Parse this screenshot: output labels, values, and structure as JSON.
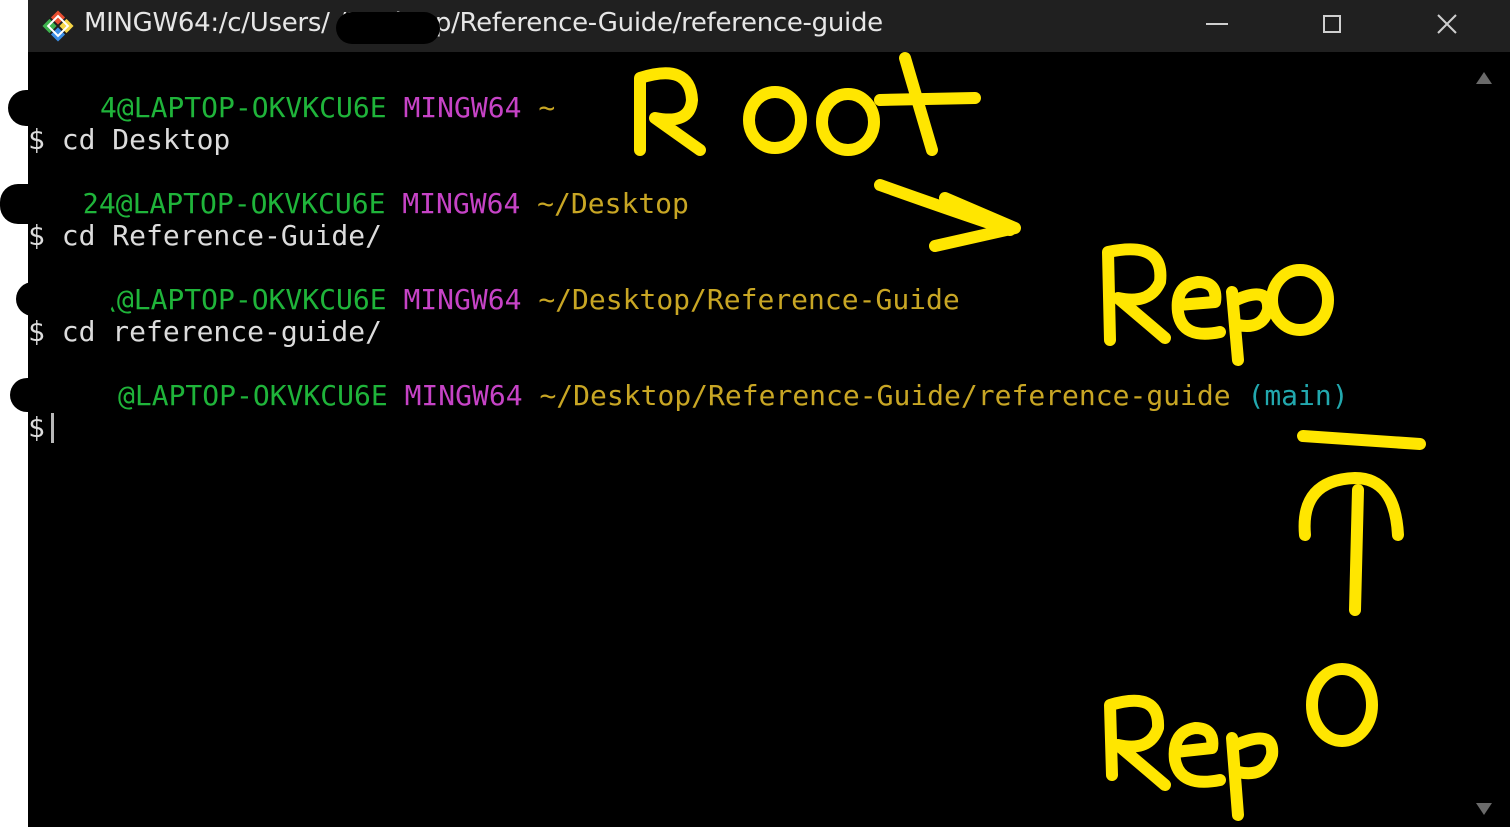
{
  "window": {
    "title": "MINGW64:/c/Users/      /Desktop/Reference-Guide/reference-guide",
    "buttons": {
      "minimize": "minimize-icon",
      "maximize": "maximize-icon",
      "close": "close-icon"
    }
  },
  "terminal": {
    "blocks": [
      {
        "user_host": "4@LAPTOP-OKVKCU6E",
        "shell": "MINGW64",
        "path": "~",
        "branch": "",
        "command": "$ cd Desktop"
      },
      {
        "user_host": "24@LAPTOP-OKVKCU6E",
        "shell": "MINGW64",
        "path": "~/Desktop",
        "branch": "",
        "command": "$ cd Reference-Guide/"
      },
      {
        "user_host": "\\@LAPTOP-OKVKCU6E",
        "shell": "MINGW64",
        "path": "~/Desktop/Reference-Guide",
        "branch": "",
        "command": "$ cd reference-guide/"
      },
      {
        "user_host": "@LAPTOP-OKVKCU6E",
        "shell": "MINGW64",
        "path": "~/Desktop/Reference-Guide/reference-guide",
        "branch": "(main)",
        "command": "$"
      }
    ]
  },
  "annotations": {
    "color": "#ffe600",
    "labels": [
      "Root",
      "Repo",
      "Repo"
    ]
  },
  "colors": {
    "user_host": "#1fb43a",
    "shell": "#c643c6",
    "path": "#c8a624",
    "branch": "#22a8ae"
  }
}
